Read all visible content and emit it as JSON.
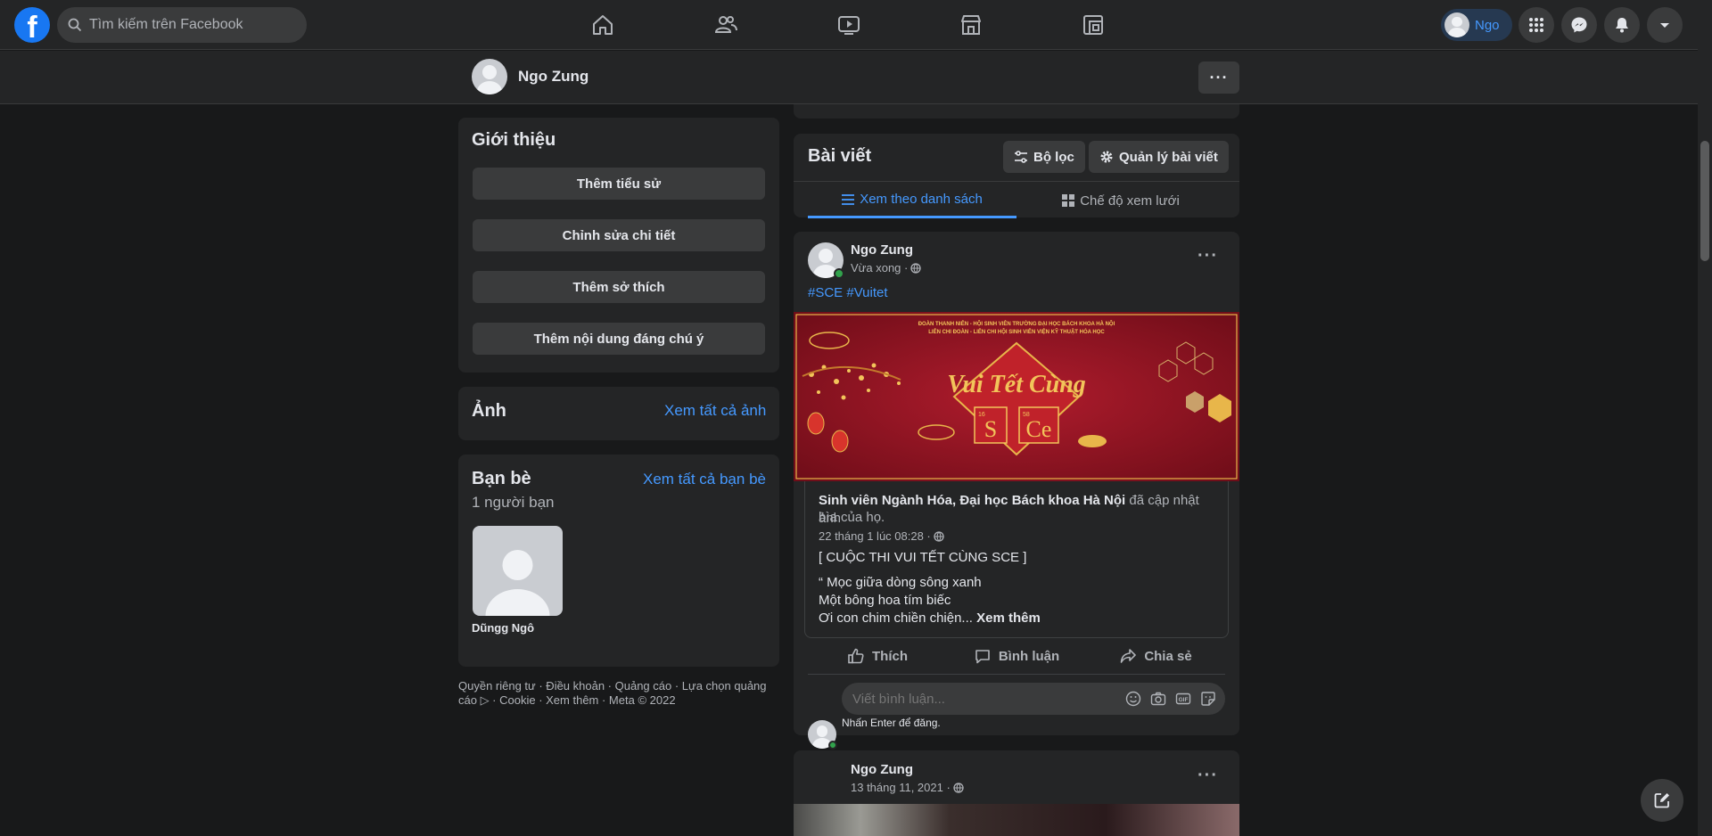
{
  "nav": {
    "logo": "f",
    "search_placeholder": "Tìm kiếm trên Facebook",
    "tabs": [
      "home-icon",
      "friends-icon",
      "watch-icon",
      "marketplace-icon",
      "groups-icon"
    ],
    "profile_name": "Ngo",
    "right_icons": [
      "menu-grid-icon",
      "messenger-icon",
      "notifications-icon",
      "account-caret-icon"
    ]
  },
  "subheader": {
    "name": "Ngo Zung",
    "more": "···"
  },
  "intro": {
    "title": "Giới thiệu",
    "buttons": [
      "Thêm tiểu sử",
      "Chỉnh sửa chi tiết",
      "Thêm sở thích",
      "Thêm nội dung đáng chú ý"
    ]
  },
  "photos": {
    "title": "Ảnh",
    "link": "Xem tất cả ảnh"
  },
  "friends": {
    "title": "Bạn bè",
    "link": "Xem tất cả bạn bè",
    "count": "1 người bạn",
    "list": [
      {
        "name": "Dũngg Ngô"
      }
    ]
  },
  "footer": {
    "line1": "Quyền riêng tư · Điều khoản · Quảng cáo · Lựa chọn quảng",
    "line2": "cáo ▷ · Cookie · Xem thêm · Meta © 2022"
  },
  "posts_header": {
    "title": "Bài viết",
    "filter": "Bộ lọc",
    "manage": "Quản lý bài viết",
    "tab_list": "Xem theo danh sách",
    "tab_grid": "Chế độ xem lưới"
  },
  "post1": {
    "author": "Ngo Zung",
    "time": "Vừa xong ·",
    "hashtags": "#SCE #Vuitet",
    "banner": {
      "header1": "ĐOÀN THANH NIÊN - HỘI SINH VIÊN TRƯỜNG ĐẠI HỌC BÁCH KHOA HÀ NỘI",
      "header2": "LIÊN CHI ĐOÀN - LIÊN CHI HỘI SINH VIÊN VIỆN KỸ THUẬT HÓA HỌC",
      "title": "Vui Tết Cùng",
      "el1": "S",
      "el2": "Ce",
      "num1": "16",
      "num2": "58"
    },
    "shared_page": "Sinh viên Ngành Hóa, Đại học Bách khoa Hà Nội",
    "shared_action": " đã cập nhật ảnh",
    "shared_action2": "bìa của họ.",
    "shared_time": "22 tháng 1 lúc 08:28 ·",
    "shared_title": "[ CUỘC THI VUI TẾT CÙNG SCE ]",
    "lines": [
      "“ Mọc giữa dòng sông xanh",
      "Một bông hoa tím biếc",
      "Ơi con chim chiền chiện..."
    ],
    "see_more": " Xem thêm",
    "like": "Thích",
    "comment": "Bình luận",
    "share": "Chia sẻ",
    "comment_placeholder": "Viết bình luận...",
    "enter_hint": "Nhấn Enter để đăng."
  },
  "post2": {
    "author": "Ngo Zung",
    "time": "13 tháng 11, 2021 ·"
  },
  "colors": {
    "accent": "#4599ff",
    "banner_red": "#9e1726",
    "gold": "#e8b64a"
  }
}
